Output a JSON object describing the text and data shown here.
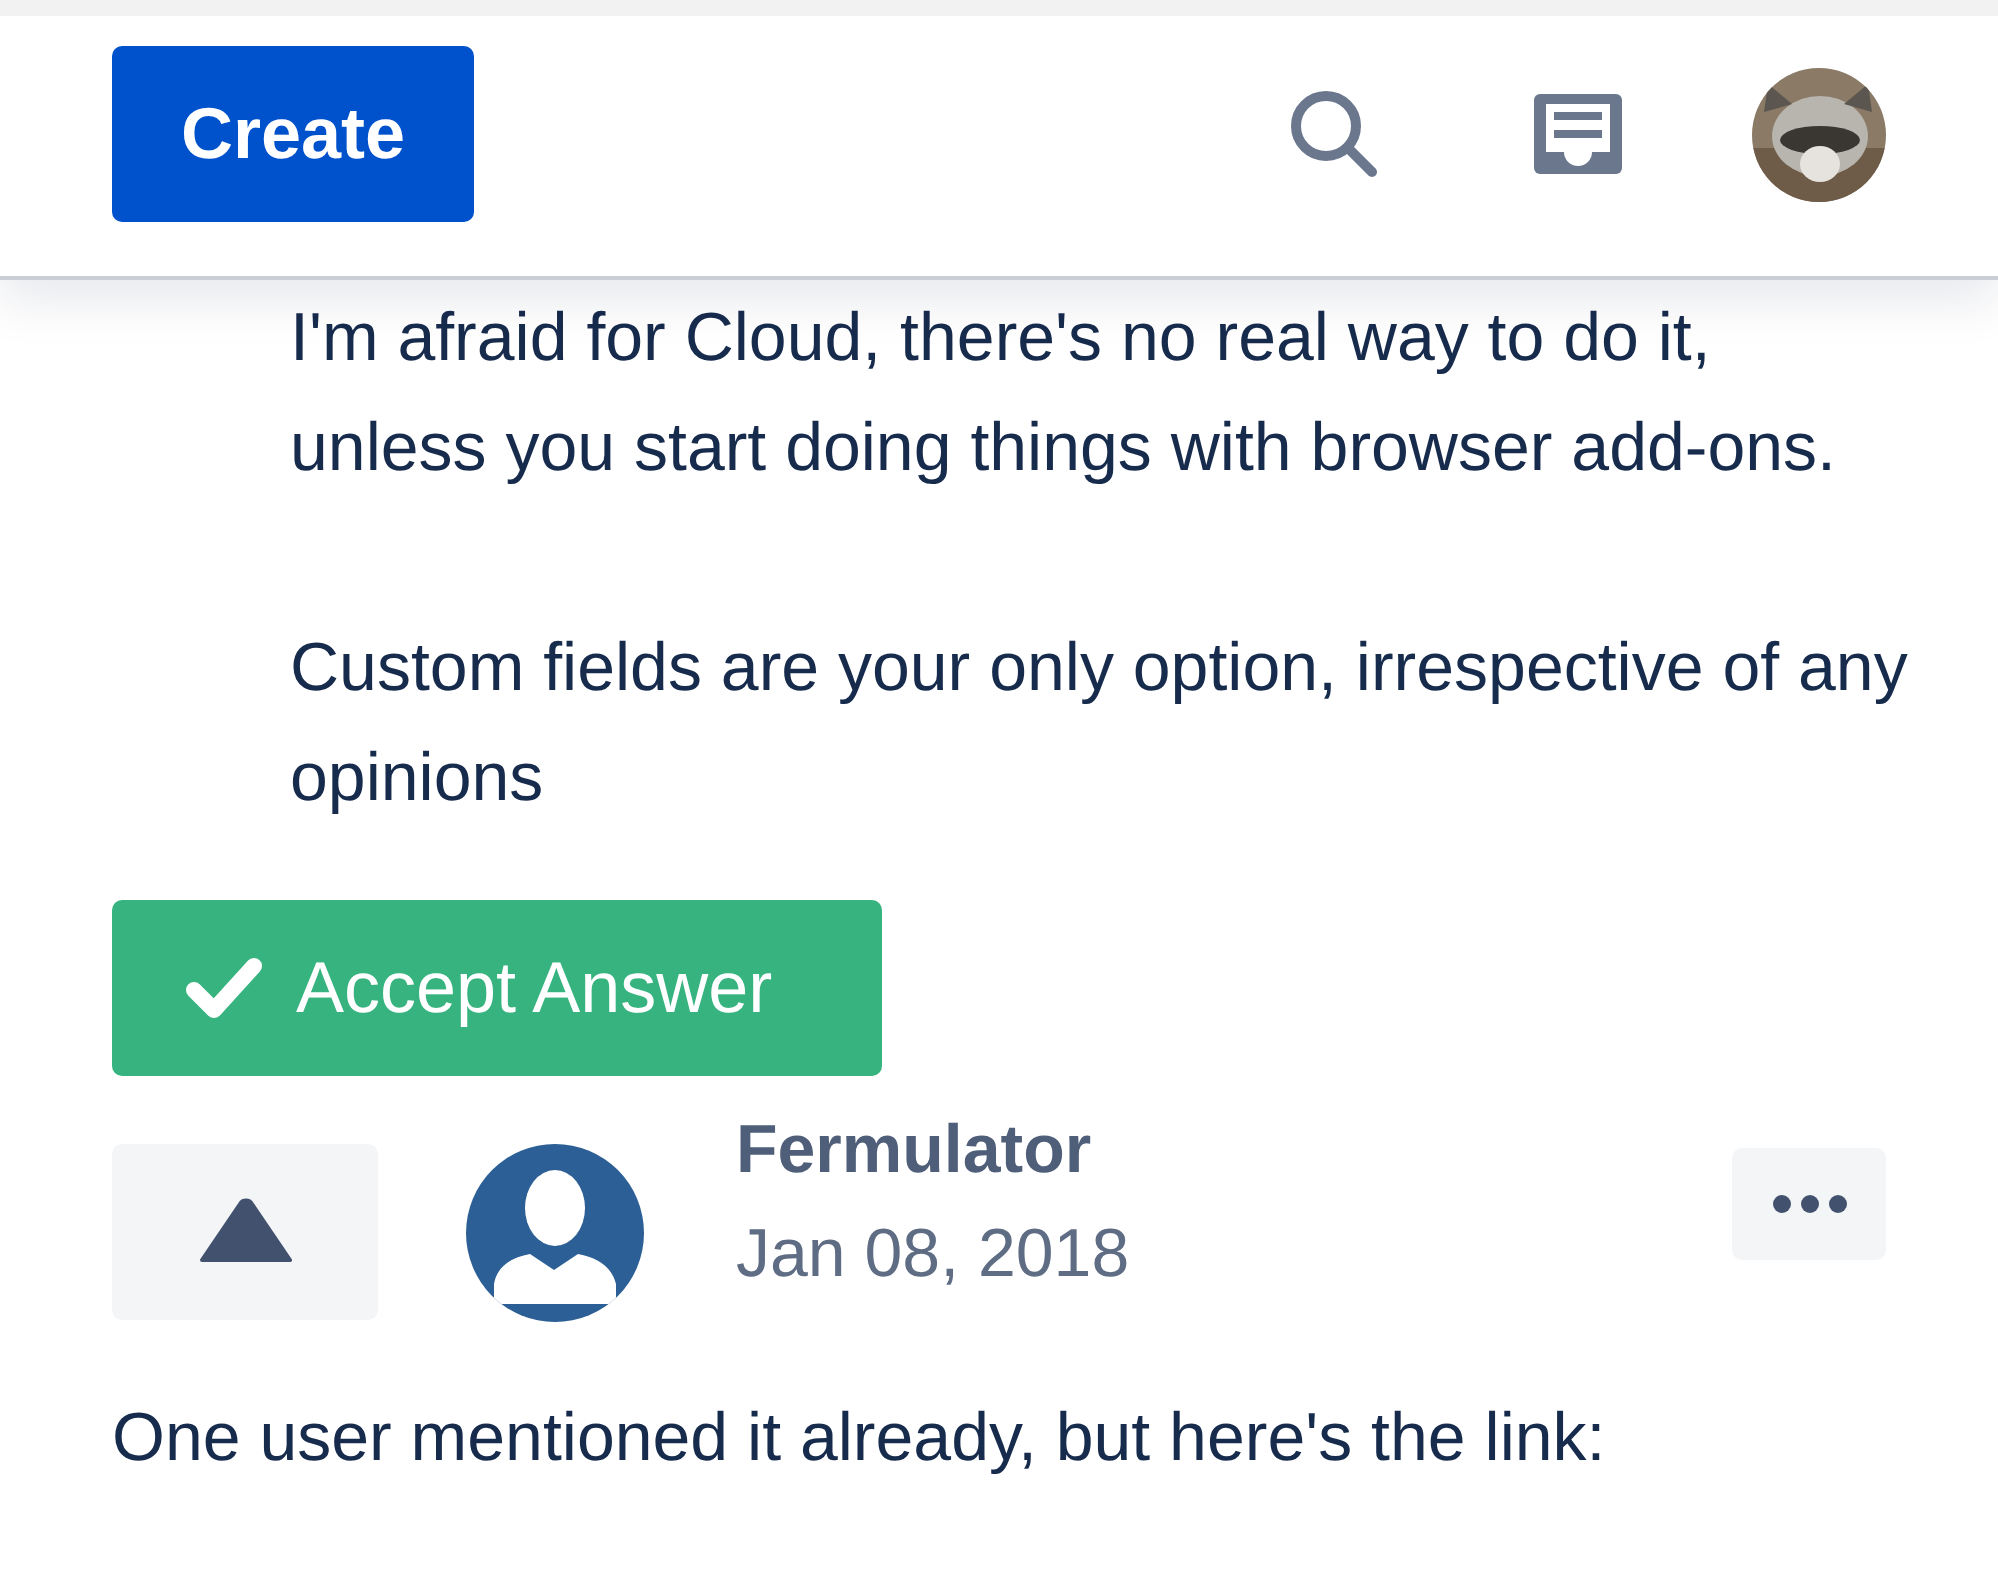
{
  "header": {
    "create_button": "Create"
  },
  "answer": {
    "paragraphs": [
      "I'm afraid for Cloud, there's no real way to do it, unless you start doing things with browser add-ons.",
      "Custom fields are your only option, irrespective of any opinions"
    ],
    "accept_button": "Accept Answer"
  },
  "reply": {
    "author": "Fermulator",
    "date": "Jan 08, 2018",
    "text": "One user mentioned it already, but here's the link:"
  }
}
